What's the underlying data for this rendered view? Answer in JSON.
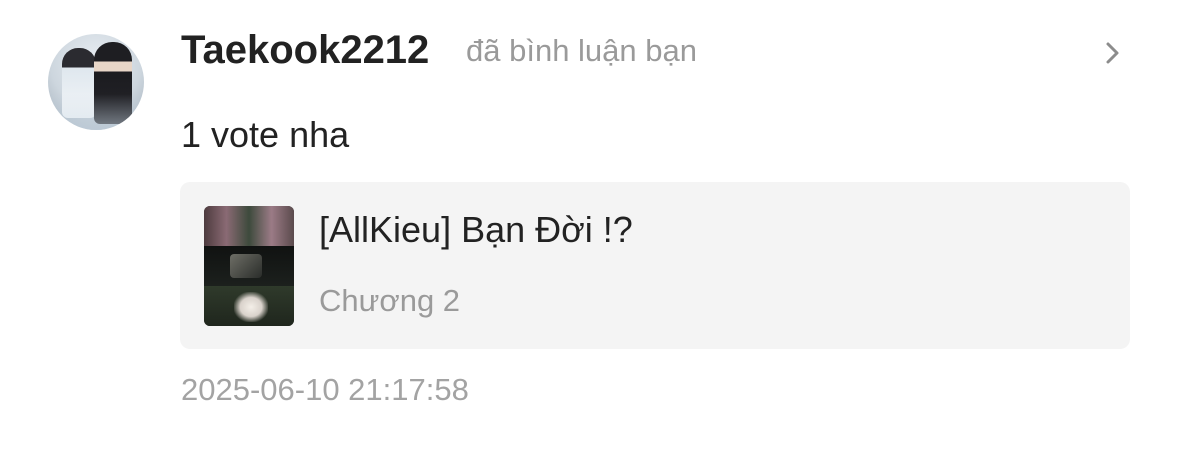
{
  "notification": {
    "username": "Taekook2212",
    "action": "đã bình luận bạn",
    "comment": "1 vote nha",
    "story": {
      "title": "[AllKieu] Bạn Đời !?",
      "chapter": "Chương 2"
    },
    "timestamp": "2025-06-10 21:17:58"
  },
  "icons": {
    "chevron": "chevron-right-icon"
  },
  "colors": {
    "primary_text": "#222222",
    "secondary_text": "#9a9a9a",
    "card_background": "#f4f4f4"
  }
}
